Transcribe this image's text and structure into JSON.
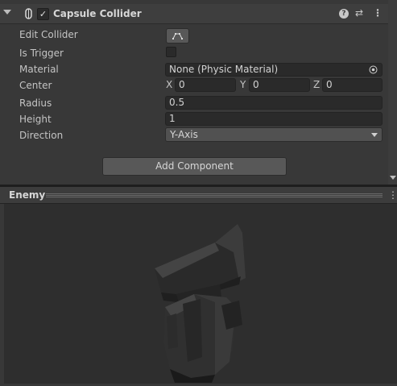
{
  "component": {
    "title": "Capsule Collider",
    "enabled_check": "✓",
    "header_icons": [
      "help-icon",
      "preset-icon",
      "more-icon"
    ],
    "help_glyph": "?",
    "preset_glyph": "⇄",
    "more_glyph": "⋮"
  },
  "fields": {
    "edit_collider_label": "Edit Collider",
    "is_trigger_label": "Is Trigger",
    "material_label": "Material",
    "material_value": "None (Physic Material)",
    "center_label": "Center",
    "center_x_axis": "X",
    "center_x": "0",
    "center_y_axis": "Y",
    "center_y": "0",
    "center_z_axis": "Z",
    "center_z": "0",
    "radius_label": "Radius",
    "radius_value": "0.5",
    "height_label": "Height",
    "height_value": "1",
    "direction_label": "Direction",
    "direction_value": "Y-Axis"
  },
  "add_component_label": "Add Component",
  "preview": {
    "title": "Enemy",
    "menu_glyph": "⋮"
  },
  "colors": {
    "panel_bg": "#383838",
    "field_bg": "#2a2a2a",
    "button_bg": "#585858",
    "preview_bg": "#2e2e2e"
  }
}
